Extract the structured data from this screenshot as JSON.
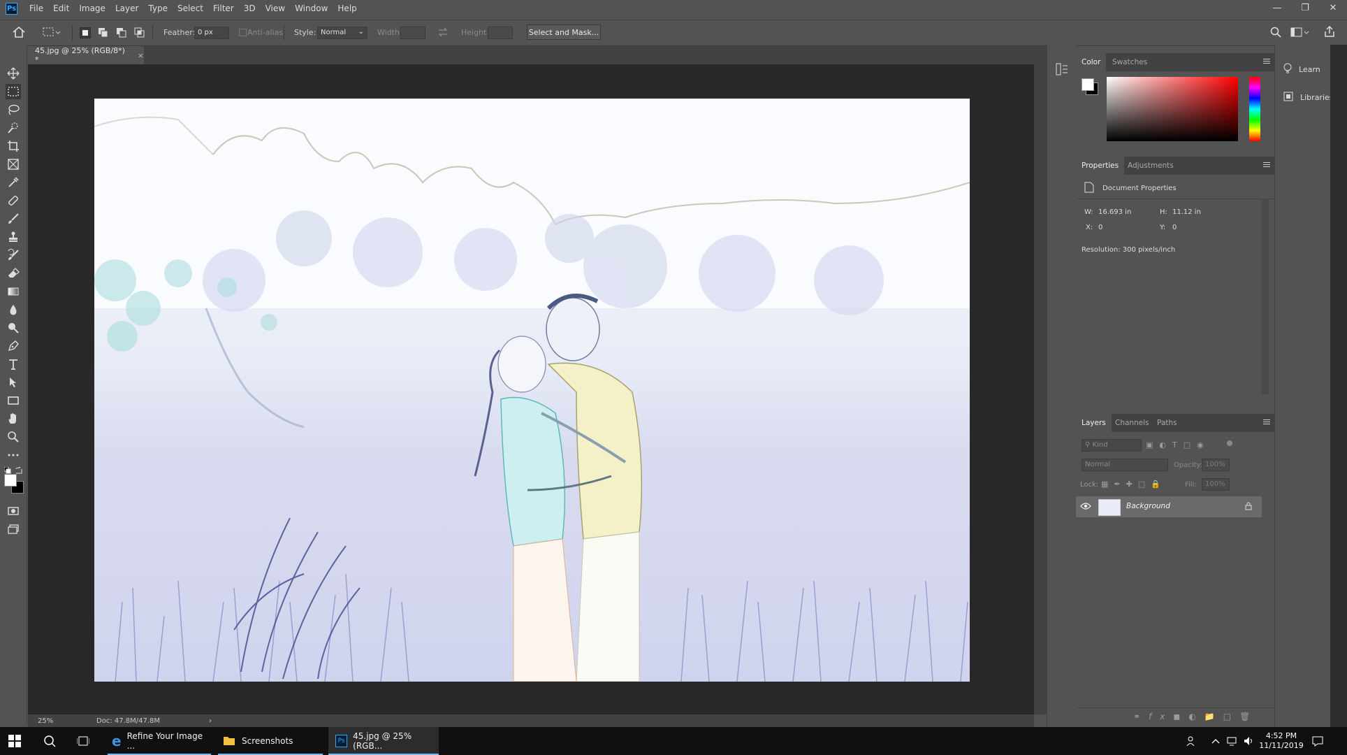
{
  "app": {
    "logo_text": "Ps"
  },
  "menu": [
    "File",
    "Edit",
    "Image",
    "Layer",
    "Type",
    "Select",
    "Filter",
    "3D",
    "View",
    "Window",
    "Help"
  ],
  "options_bar": {
    "feather_label": "Feather:",
    "feather_value": "0 px",
    "anti_alias_label": "Anti-alias",
    "style_label": "Style:",
    "style_value": "Normal",
    "width_label": "Width:",
    "height_label": "Height:",
    "select_mask_label": "Select and Mask..."
  },
  "document": {
    "tab_title": "45.jpg @ 25% (RGB/8*) *",
    "zoom": "25%",
    "doc_size": "Doc: 47.8M/47.8M"
  },
  "color_panel": {
    "tabs": [
      "Color",
      "Swatches"
    ],
    "foreground": "#ffffff",
    "background": "#000000",
    "hue_color": "#ff0000"
  },
  "properties_panel": {
    "tabs": [
      "Properties",
      "Adjustments"
    ],
    "section_title": "Document Properties",
    "w_label": "W:",
    "w_value": "16.693 in",
    "h_label": "H:",
    "h_value": "11.12 in",
    "x_label": "X:",
    "x_value": "0",
    "y_label": "Y:",
    "y_value": "0",
    "resolution": "Resolution: 300 pixels/inch"
  },
  "layers_panel": {
    "tabs": [
      "Layers",
      "Channels",
      "Paths"
    ],
    "kind_placeholder": "Kind",
    "blend_mode": "Normal",
    "opacity_label": "Opacity:",
    "opacity_value": "100%",
    "lock_label": "Lock:",
    "fill_label": "Fill:",
    "fill_value": "100%",
    "layers": [
      {
        "name": "Background",
        "visible": true,
        "locked": true
      }
    ]
  },
  "side_panel": {
    "learn": "Learn",
    "libraries": "Libraries"
  },
  "taskbar": {
    "items": [
      "Refine Your Image ...",
      "Screenshots",
      "45.jpg @ 25% (RGB..."
    ],
    "time": "4:52 PM",
    "date": "11/11/2019"
  }
}
